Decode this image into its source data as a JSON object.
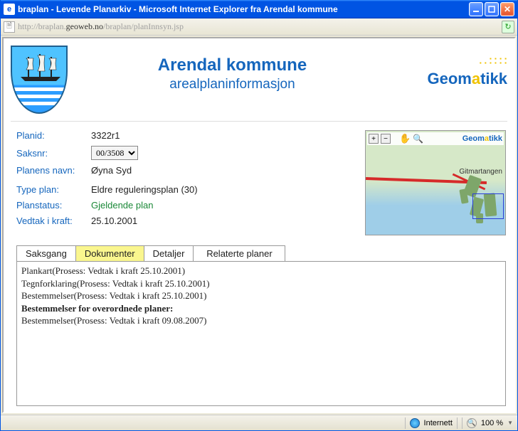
{
  "window": {
    "title": "braplan - Levende Planarkiv - Microsoft Internet Explorer fra Arendal kommune",
    "url_pre": "http://braplan.",
    "url_dark": "geoweb.no",
    "url_post": "/braplan/planInnsyn.jsp"
  },
  "header": {
    "title": "Arendal kommune",
    "subtitle": "arealplaninformasjon",
    "geomatikk": "Geomatikk"
  },
  "fields": {
    "planid_label": "Planid:",
    "planid_value": "3322r1",
    "saksnr_label": "Saksnr:",
    "saksnr_value": "00/3508",
    "plannavn_label": "Planens navn:",
    "plannavn_value": "Øyna Syd",
    "typeplan_label": "Type plan:",
    "typeplan_value": "Eldre reguleringsplan (30)",
    "planstatus_label": "Planstatus:",
    "planstatus_value": "Gjeldende plan",
    "vedtak_label": "Vedtak i kraft:",
    "vedtak_value": "25.10.2001"
  },
  "map": {
    "label": "Gitmartangen",
    "logo": "Geomatikk"
  },
  "tabs": {
    "t1": "Saksgang",
    "t2": "Dokumenter",
    "t3": "Detaljer",
    "t4": "Relaterte planer"
  },
  "docs": {
    "l1": "Plankart(Prosess: Vedtak i kraft 25.10.2001)",
    "l2": "Tegnforklaring(Prosess: Vedtak i kraft 25.10.2001)",
    "l3": "Bestemmelser(Prosess: Vedtak i kraft 25.10.2001)",
    "hdr": "Bestemmelser for overordnede planer:",
    "l4": "Bestemmelser(Prosess: Vedtak i kraft 09.08.2007)"
  },
  "status": {
    "zone": "Internett",
    "zoom": "100 %"
  }
}
